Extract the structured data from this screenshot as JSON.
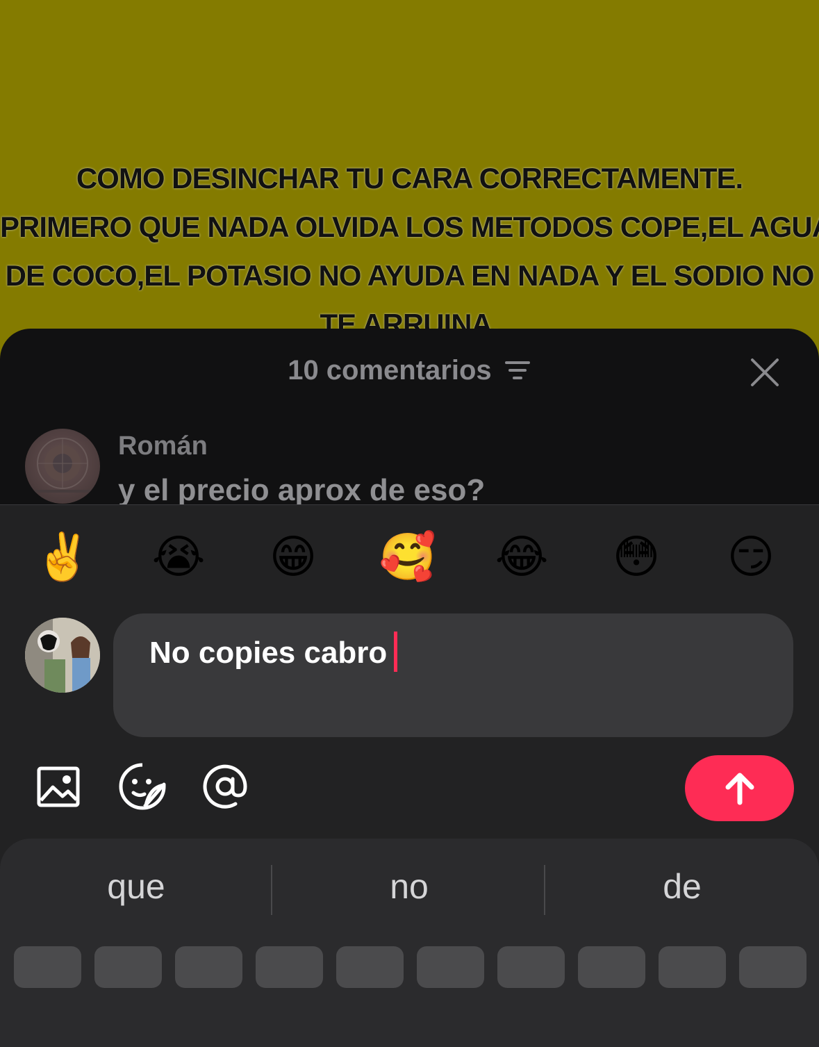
{
  "video": {
    "caption_lines": [
      "COMO DESINCHAR TU CARA CORRECTAMENTE.",
      "PRIMERO QUE NADA OLVIDA LOS METODOS COPE,EL AGUA",
      "DE COCO,EL POTASIO NO AYUDA EN NADA Y EL SODIO NO",
      "TE ARRUINA."
    ],
    "background_color": "#857800"
  },
  "comments_sheet": {
    "count_label": "10 comentarios",
    "filter_icon": "filter-lines-icon",
    "close_icon": "close-icon"
  },
  "comment": {
    "user": "Román",
    "text": "y el precio aprox de eso?"
  },
  "quick_emojis": [
    "✌️",
    "😭",
    "😁",
    "🥰",
    "😂",
    "😳",
    "😏"
  ],
  "composer": {
    "input_value": "No copies cabro",
    "accent_color": "#fe2c55",
    "tools": [
      "image-icon",
      "sticker-icon",
      "mention-icon"
    ],
    "send_icon": "arrow-up-icon"
  },
  "keyboard": {
    "suggestions": [
      "que",
      "no",
      "de"
    ]
  }
}
